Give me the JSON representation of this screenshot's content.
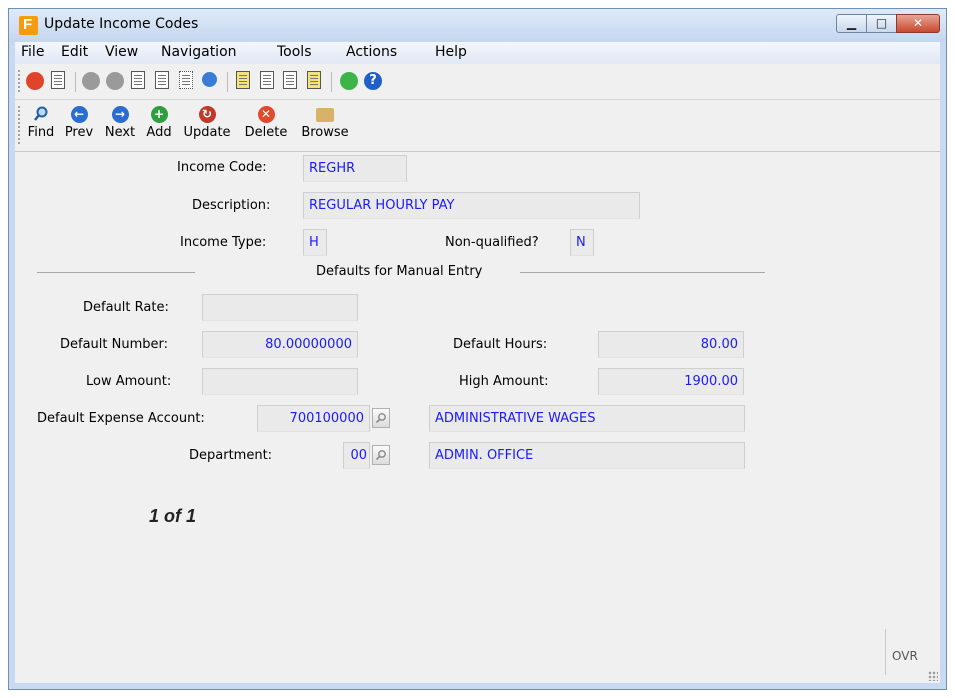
{
  "window": {
    "title": "Update Income Codes"
  },
  "menu": [
    "File",
    "Edit",
    "View",
    "Navigation",
    "Tools",
    "Actions",
    "Help"
  ],
  "toolbar_actions": {
    "find": "Find",
    "prev": "Prev",
    "next": "Next",
    "add": "Add",
    "update": "Update",
    "delete": "Delete",
    "browse": "Browse"
  },
  "form": {
    "income_code": {
      "label": "Income Code:",
      "value": "REGHR"
    },
    "description": {
      "label": "Description:",
      "value": "REGULAR HOURLY PAY"
    },
    "income_type": {
      "label": "Income Type:",
      "value": "H"
    },
    "non_qualified": {
      "label": "Non-qualified?",
      "value": "N"
    },
    "section_title": "Defaults for Manual Entry",
    "default_rate": {
      "label": "Default Rate:",
      "value": ""
    },
    "default_number": {
      "label": "Default Number:",
      "value": "80.00000000"
    },
    "default_hours": {
      "label": "Default Hours:",
      "value": "80.00"
    },
    "low_amount": {
      "label": "Low Amount:",
      "value": ""
    },
    "high_amount": {
      "label": "High Amount:",
      "value": "1900.00"
    },
    "expense_account": {
      "label": "Default Expense Account:",
      "value": "700100000",
      "description": "ADMINISTRATIVE WAGES"
    },
    "department": {
      "label": "Department:",
      "value": "00",
      "description": "ADMIN. OFFICE"
    }
  },
  "record_counter": "1 of 1",
  "status": {
    "ovr": "OVR"
  },
  "colors": {
    "field_text": "#1a1aff",
    "form_bg": "#f0f0f0",
    "frame": "#c7daf1"
  }
}
